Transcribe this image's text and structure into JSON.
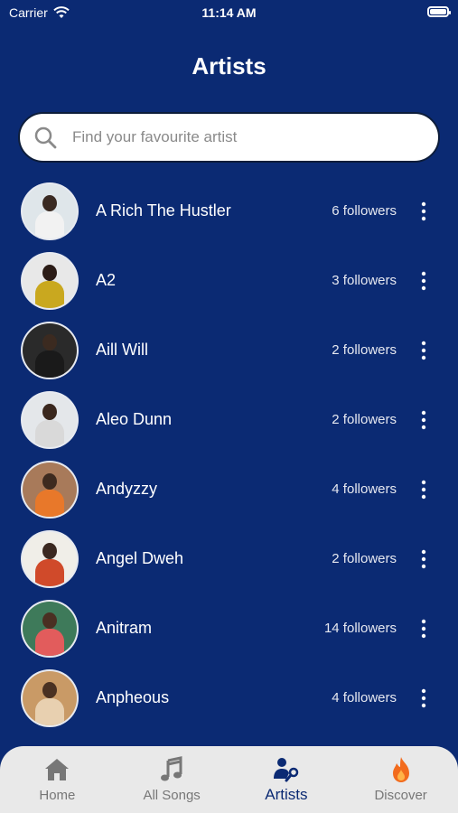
{
  "status": {
    "carrier": "Carrier",
    "time": "11:14 AM"
  },
  "page_title": "Artists",
  "search": {
    "placeholder": "Find your favourite artist"
  },
  "artists": [
    {
      "name": "A Rich The Hustler",
      "followers": "6 followers",
      "bg": "#dfe6ea",
      "skin": "#3a2a22",
      "cloth": "#f2f2f2"
    },
    {
      "name": "A2",
      "followers": "3 followers",
      "bg": "#e8e8e8",
      "skin": "#2b1c16",
      "cloth": "#c9a81f"
    },
    {
      "name": "Aill Will",
      "followers": "2 followers",
      "bg": "#2a2a2a",
      "skin": "#3b2a20",
      "cloth": "#1a1a1a"
    },
    {
      "name": "Aleo Dunn",
      "followers": "2 followers",
      "bg": "#e4e7ea",
      "skin": "#3a271d",
      "cloth": "#d9d9d9"
    },
    {
      "name": "Andyzzy",
      "followers": "4 followers",
      "bg": "#a87a5a",
      "skin": "#3d2a1f",
      "cloth": "#e8782a"
    },
    {
      "name": "Angel Dweh",
      "followers": "2 followers",
      "bg": "#f0eee8",
      "skin": "#3a2820",
      "cloth": "#d04a2a"
    },
    {
      "name": "Anitram",
      "followers": "14 followers",
      "bg": "#3e7a5a",
      "skin": "#4a2f22",
      "cloth": "#e25c5c"
    },
    {
      "name": "Anpheous",
      "followers": "4 followers",
      "bg": "#c99a66",
      "skin": "#4a3122",
      "cloth": "#e8d0b0"
    }
  ],
  "tabs": [
    {
      "label": "Home",
      "icon": "home-icon"
    },
    {
      "label": "All Songs",
      "icon": "music-note-icon"
    },
    {
      "label": "Artists",
      "icon": "artist-icon"
    },
    {
      "label": "Discover",
      "icon": "flame-icon"
    }
  ],
  "colors": {
    "background": "#0b2a73",
    "tabbar": "#e9e9e9",
    "active_tab": "#0b2a73",
    "inactive_tab": "#777777",
    "flame": "#f26b1d"
  }
}
